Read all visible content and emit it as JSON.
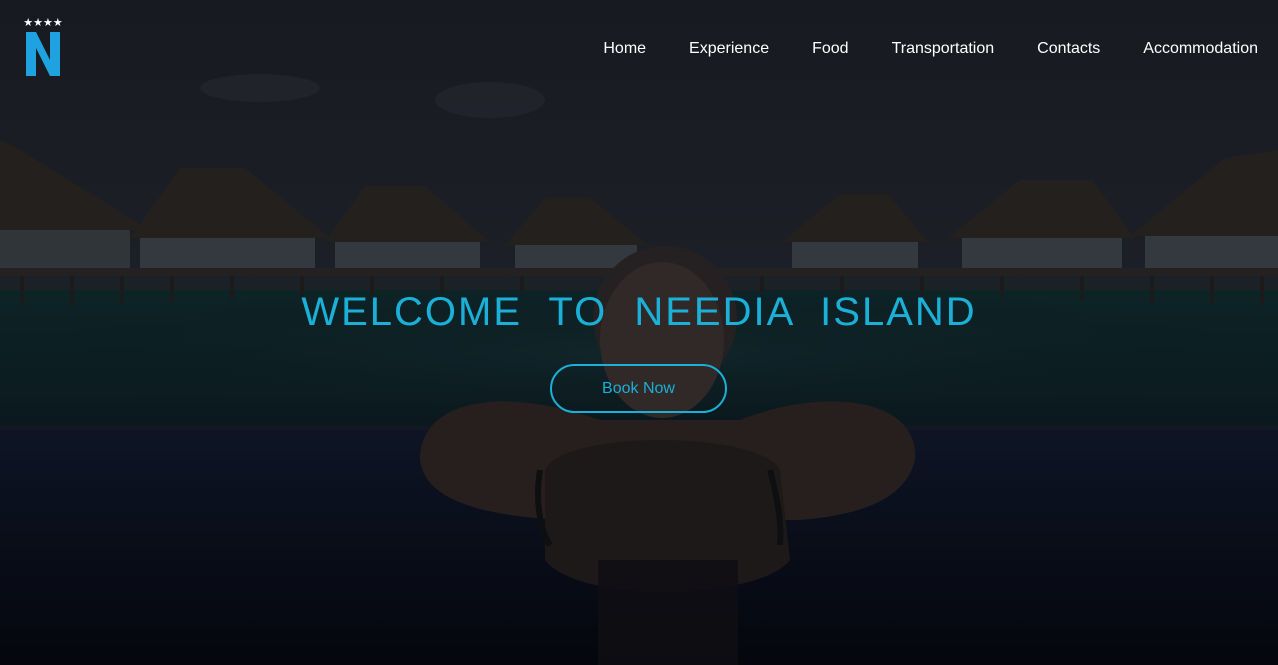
{
  "brand": {
    "stars": "★★★★",
    "letter": "N",
    "accent_color": "#1ab0d8",
    "logo_color": "#1ea3e0"
  },
  "nav": {
    "items": [
      {
        "label": "Home"
      },
      {
        "label": "Experience"
      },
      {
        "label": "Food"
      },
      {
        "label": "Transportation"
      },
      {
        "label": "Contacts"
      },
      {
        "label": "Accommodation"
      }
    ]
  },
  "hero": {
    "headline": "WELCOME TO NEEDIA ISLAND",
    "cta_label": "Book Now"
  }
}
